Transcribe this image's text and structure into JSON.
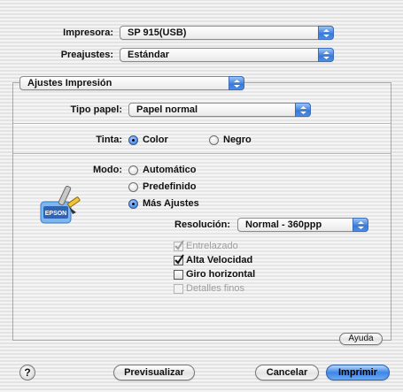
{
  "printer": {
    "label": "Impresora:",
    "value": "SP 915(USB)"
  },
  "presets": {
    "label": "Preajustes:",
    "value": "Estándar"
  },
  "panel_menu": {
    "value": "Ajustes Impresión"
  },
  "paper_type": {
    "label": "Tipo papel:",
    "value": "Papel normal"
  },
  "ink": {
    "label": "Tinta:",
    "options": [
      "Color",
      "Negro"
    ],
    "selected": "Color"
  },
  "mode": {
    "label": "Modo:",
    "options": [
      "Automático",
      "Predefinido",
      "Más Ajustes"
    ],
    "selected": "Más Ajustes",
    "logo_text": "EPSON"
  },
  "resolution": {
    "label": "Resolución:",
    "value": "Normal - 360ppp"
  },
  "checkboxes": [
    {
      "label": "Entrelazado",
      "checked": true,
      "enabled": false
    },
    {
      "label": "Alta Velocidad",
      "checked": true,
      "enabled": true
    },
    {
      "label": "Giro horizontal",
      "checked": false,
      "enabled": true
    },
    {
      "label": "Detalles finos",
      "checked": false,
      "enabled": false
    }
  ],
  "buttons": {
    "help_symbol": "?",
    "ayuda": "Ayuda",
    "preview": "Previsualizar",
    "cancel": "Cancelar",
    "print": "Imprimir"
  },
  "colors": {
    "accent": "#3779d8",
    "background": "#ececec",
    "disabled_text": "#a0a0a0"
  }
}
